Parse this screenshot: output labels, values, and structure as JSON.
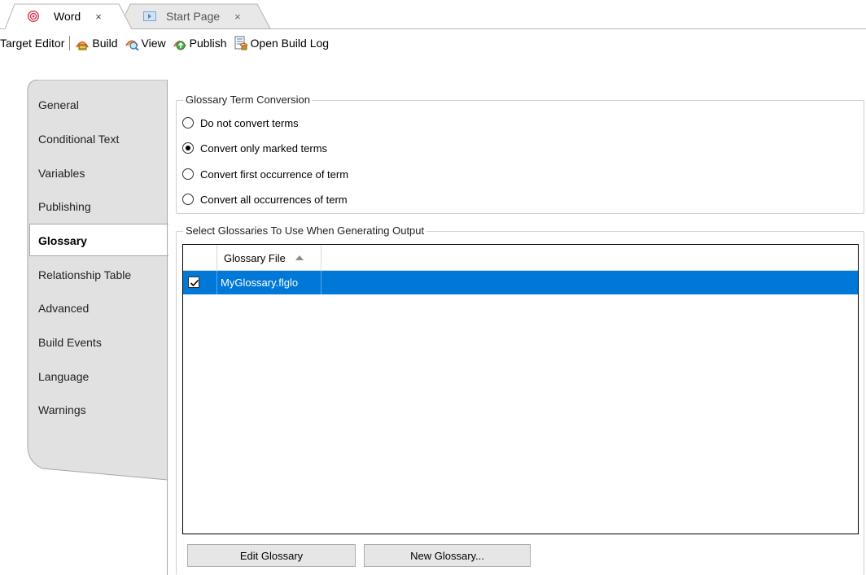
{
  "tabs": [
    {
      "label": "Word",
      "close": "×",
      "active": true,
      "icon": "word-target-icon"
    },
    {
      "label": "Start Page",
      "close": "×",
      "active": false,
      "icon": "start-page-icon"
    }
  ],
  "toolbar": {
    "title": "Target Editor",
    "items": [
      {
        "label": "Build",
        "icon": "build-icon"
      },
      {
        "label": "View",
        "icon": "view-icon"
      },
      {
        "label": "Publish",
        "icon": "publish-icon"
      },
      {
        "label": "Open Build Log",
        "icon": "build-log-icon"
      }
    ]
  },
  "sidebar": {
    "items": [
      {
        "label": "General"
      },
      {
        "label": "Conditional Text"
      },
      {
        "label": "Variables"
      },
      {
        "label": "Publishing"
      },
      {
        "label": "Glossary",
        "active": true
      },
      {
        "label": "Relationship Table"
      },
      {
        "label": "Advanced"
      },
      {
        "label": "Build Events"
      },
      {
        "label": "Language"
      },
      {
        "label": "Warnings"
      }
    ]
  },
  "conversion": {
    "legend": "Glossary Term Conversion",
    "options": [
      {
        "label": "Do not convert terms",
        "selected": false
      },
      {
        "label": "Convert only marked terms",
        "selected": true
      },
      {
        "label": "Convert first occurrence of term",
        "selected": false
      },
      {
        "label": "Convert all occurrences of term",
        "selected": false
      }
    ]
  },
  "glossaries": {
    "legend": "Select Glossaries To Use When Generating Output",
    "column_header": "Glossary File",
    "rows": [
      {
        "file": "MyGlossary.flglo",
        "checked": true,
        "selected": true
      }
    ],
    "buttons": {
      "edit": "Edit Glossary",
      "new": "New Glossary..."
    }
  },
  "colors": {
    "selection": "#0078d7",
    "sidebar_bg": "#e1e1e1",
    "tab_inactive_bg": "#e8e8e8"
  }
}
